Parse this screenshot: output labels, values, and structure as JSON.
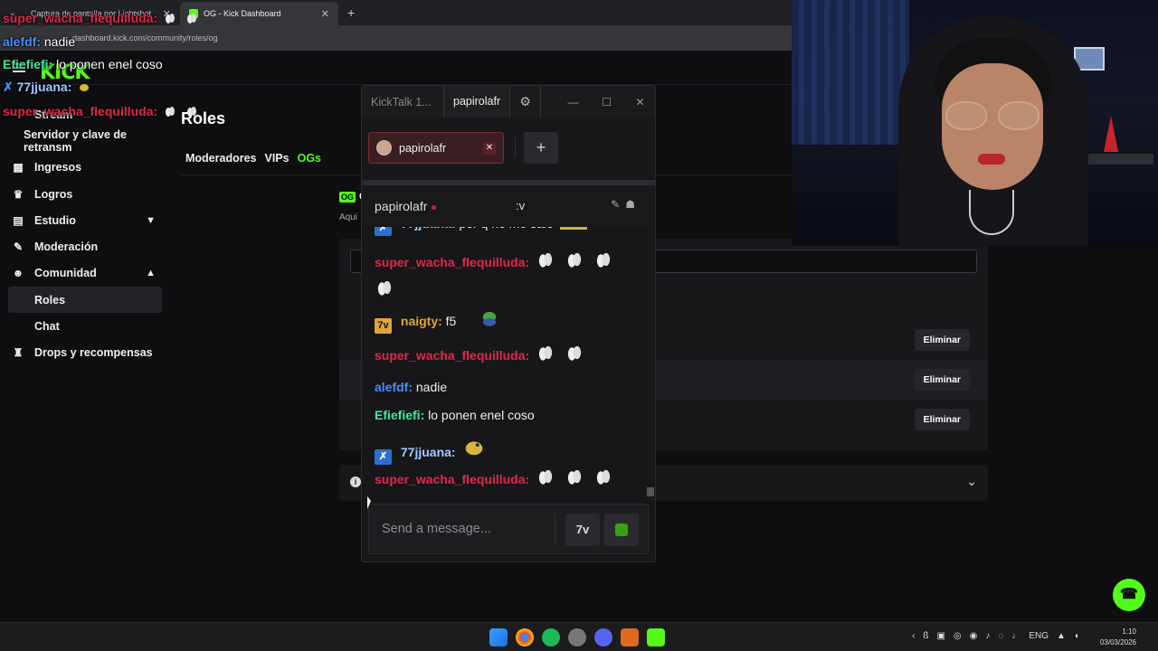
{
  "browser": {
    "tabs": [
      {
        "label": "Captura de pantalla por Lightshot",
        "active": false
      },
      {
        "label": "OG - Kick Dashboard",
        "active": true
      }
    ],
    "new_tab": "+",
    "url": "dashboard.kick.com/community/roles/og"
  },
  "dashboard": {
    "logo": "KICK",
    "sidebar": [
      {
        "label": "Stream",
        "icon": "video-icon"
      },
      {
        "label": "Servidor y clave de retransm",
        "icon": ""
      },
      {
        "label": "Ingresos",
        "icon": "money-icon"
      },
      {
        "label": "Logros",
        "icon": "trophy-icon"
      },
      {
        "label": "Estudio",
        "icon": "studio-icon"
      },
      {
        "label": "Moderación",
        "icon": "wrench-icon"
      },
      {
        "label": "Comunidad",
        "icon": "people-icon"
      },
      {
        "label": "Roles",
        "icon": ""
      },
      {
        "label": "Chat",
        "icon": ""
      },
      {
        "label": "Drops y recompensas",
        "icon": "gift-icon"
      }
    ],
    "page_title": "Roles",
    "role_tabs": [
      "Moderadores",
      "VIPs",
      "OGs"
    ],
    "og_badge": "OG",
    "og_title": "O",
    "og_description": "Aqui",
    "eliminar_label": "Eliminar",
    "accent": "#53fc18"
  },
  "overlay_chat": [
    {
      "user": "super_wacha_flequilluda:",
      "color": "#e0284a",
      "text": ""
    },
    {
      "user": "alefdf:",
      "color": "#4a8cff",
      "text": "nadie"
    },
    {
      "user": "Efiefiefi:",
      "color": "#44e6a0",
      "text": "lo ponen enel coso"
    },
    {
      "user": "77jjuana:",
      "color": "#9ec8ff",
      "text": ""
    },
    {
      "user": "super_wacha_flequilluda:",
      "color": "#e0284a",
      "text": ""
    }
  ],
  "kicktalk": {
    "app_title": "KickTalk 1...",
    "user": "papirolafr",
    "channel_tab": "papirolafr",
    "add": "+",
    "chat_channel": "papirolafr",
    "chat_topic": ":v",
    "messages": [
      {
        "user": "77jjuana:",
        "color": "#9ec8ff",
        "text": "por q no me sale"
      },
      {
        "user": "super_wacha_flequilluda:",
        "color": "#e0284a",
        "text": ""
      },
      {
        "user": "naigty:",
        "color": "#e0a43a",
        "text": "f5"
      },
      {
        "user": "super_wacha_flequilluda:",
        "color": "#e0284a",
        "text": ""
      },
      {
        "user": "alefdf:",
        "color": "#4a8cff",
        "text": "nadie"
      },
      {
        "user": "Efiefiefi:",
        "color": "#44e6a0",
        "text": "lo ponen enel coso"
      },
      {
        "user": "77jjuana:",
        "color": "#9ec8ff",
        "text": ""
      },
      {
        "user": "super_wacha_flequilluda:",
        "color": "#e0284a",
        "text": ""
      }
    ],
    "input_placeholder": "Send a message...",
    "emote_button": "7v"
  },
  "taskbar": {
    "lang": "ENG",
    "time": "1:10",
    "date": "03/03/2026"
  }
}
